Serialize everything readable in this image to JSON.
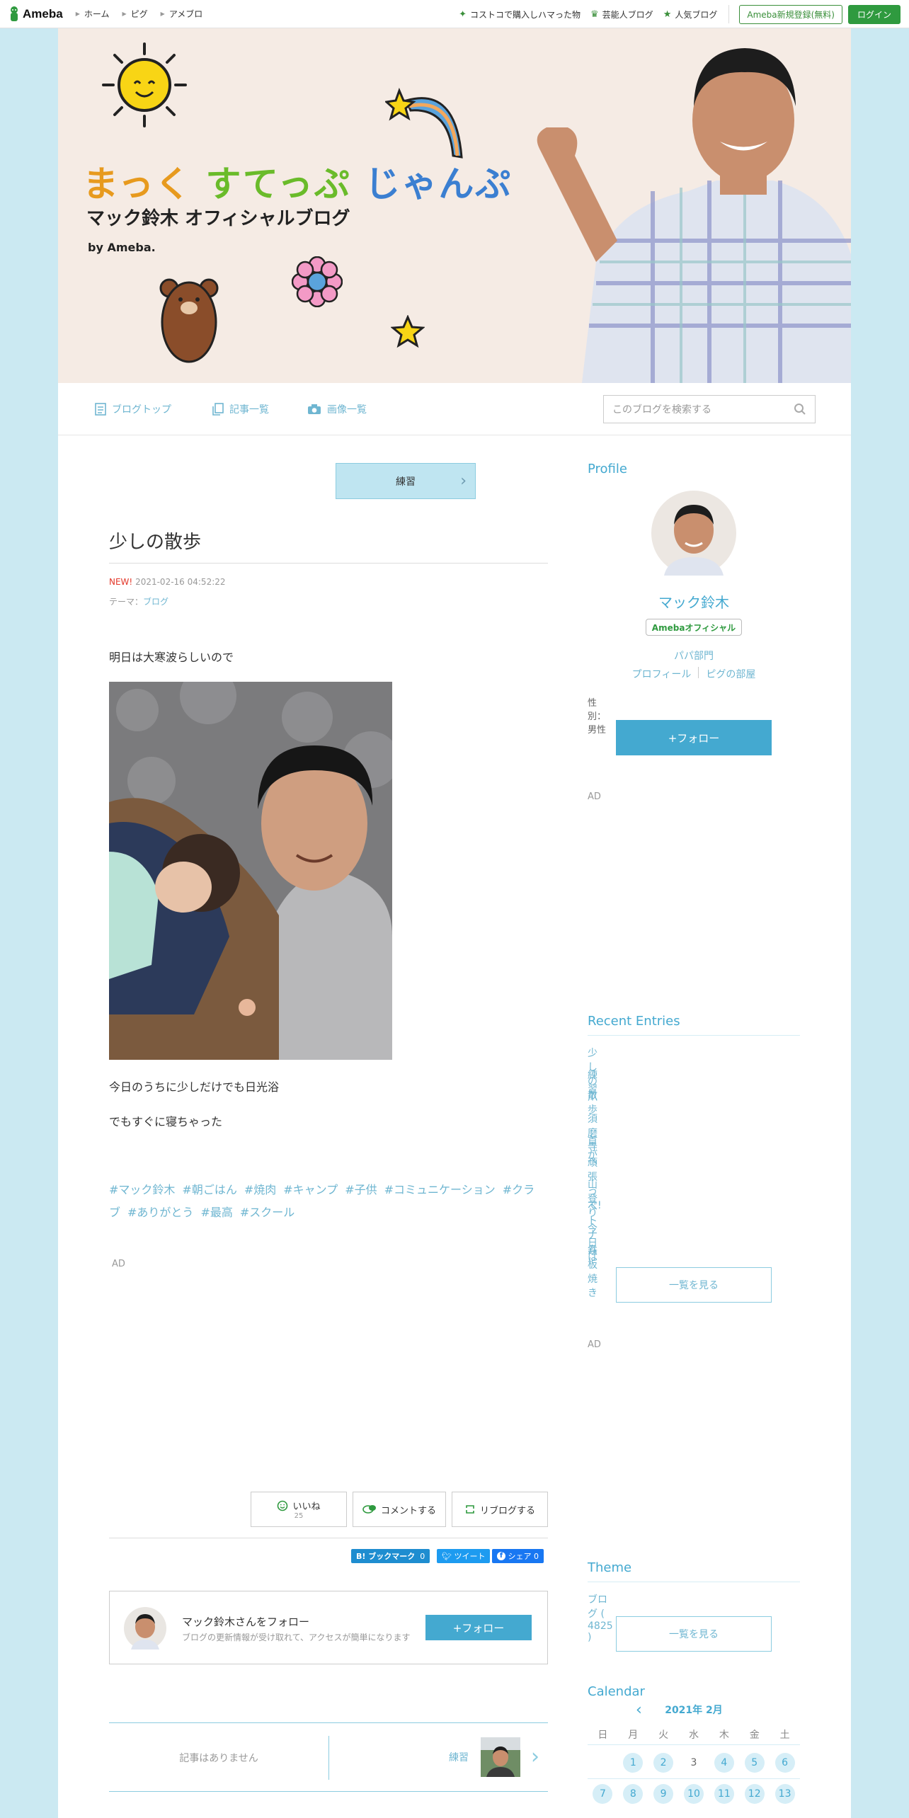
{
  "topbar": {
    "logo": "Ameba",
    "nav": [
      "ホーム",
      "ピグ",
      "アメブロ"
    ],
    "right_links": [
      "コストコで購入しハマった物",
      "芸能人ブログ",
      "人気ブログ"
    ],
    "register": "Ameba新規登録(無料)",
    "login": "ログイン"
  },
  "header": {
    "title_a": "まっく",
    "title_b": "すてっぷ",
    "title_c": "じゃんぷ",
    "subtitle": "マック鈴木 オフィシャルブログ",
    "by": "by Ameba."
  },
  "blognav": {
    "items": [
      "ブログトップ",
      "記事一覧",
      "画像一覧"
    ],
    "search_placeholder": "このブログを検索する"
  },
  "article": {
    "prev_label": "練習",
    "title": "少しの散歩",
    "new": "NEW!",
    "datetime": "2021-02-16 04:52:22",
    "theme_label": "テーマ：",
    "theme": "ブログ",
    "p1": "明日は大寒波らしいので",
    "p2": "今日のうちに少しだけでも日光浴",
    "p3": "でもすぐに寝ちゃった",
    "tags": [
      "#マック鈴木",
      "#朝ごはん",
      "#焼肉",
      "#キャンプ",
      "#子供",
      "#コミュニケーション",
      "#クラブ",
      "#ありがとう",
      "#最高",
      "#スクール"
    ],
    "ad": "AD",
    "like": "いいね",
    "like_count": "25",
    "comment": "コメントする",
    "reblog": "リブログする",
    "share_hatena": "B! ブックマーク",
    "share_hatena_count": "0",
    "share_tweet": "ツイート",
    "share_fb": "シェア",
    "share_fb_count": "0",
    "follow_title": "マック鈴木さんをフォロー",
    "follow_sub": "ブログの更新情報が受け取れて、アクセスが簡単になります",
    "follow_btn": "+フォロー",
    "pager_none": "記事はありません",
    "pager_next": "練習"
  },
  "sidebar": {
    "profile_h": "Profile",
    "name": "マック鈴木",
    "badge": "Amebaオフィシャル",
    "group": "パパ部門",
    "profile_link": "プロフィール",
    "pig_link": "ピグの部屋",
    "gender": "性別：男性",
    "follow": "+フォロー",
    "ad": "AD",
    "recent_h": "Recent Entries",
    "recent": [
      "少しの散歩",
      "練習",
      "爪",
      "須磨寺へ",
      "首が",
      "頑張って!",
      "山登り",
      "ベトナム",
      "今日は",
      "鉄板焼き"
    ],
    "see_all": "一覧を見る",
    "theme_h": "Theme",
    "theme_item": "ブログ ( 4825 )",
    "calendar_h": "Calendar",
    "cal_month": "2021年 2月",
    "weekdays": [
      "日",
      "月",
      "火",
      "水",
      "木",
      "金",
      "土"
    ],
    "week1": [
      "",
      "1",
      "2",
      "3",
      "4",
      "5",
      "6"
    ],
    "week2": [
      "7",
      "8",
      "9",
      "10",
      "11",
      "12",
      "13"
    ]
  },
  "colors": {
    "accent": "#44a9d0",
    "link": "#6fb6d1",
    "green": "#2f9a3f",
    "bg": "#cbe9f2"
  }
}
